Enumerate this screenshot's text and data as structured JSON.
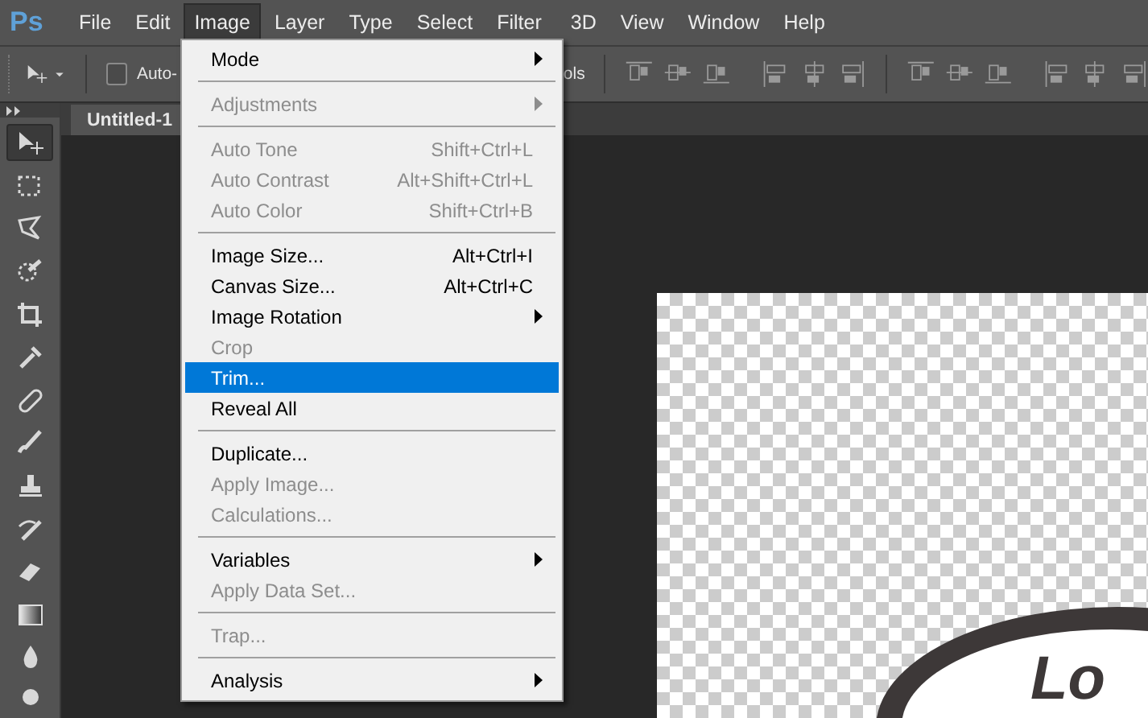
{
  "menubar": {
    "logo": "Ps",
    "items": [
      {
        "label": "File",
        "selected": false
      },
      {
        "label": "Edit",
        "selected": false
      },
      {
        "label": "Image",
        "selected": true
      },
      {
        "label": "Layer",
        "selected": false
      },
      {
        "label": "Type",
        "selected": false
      },
      {
        "label": "Select",
        "selected": false
      },
      {
        "label": "Filter",
        "selected": false
      },
      {
        "label": "3D",
        "selected": false
      },
      {
        "label": "View",
        "selected": false
      },
      {
        "label": "Window",
        "selected": false
      },
      {
        "label": "Help",
        "selected": false
      }
    ]
  },
  "options_bar": {
    "auto_select": {
      "label": "Auto-",
      "checked": false
    },
    "transform_label": "ols"
  },
  "document_tab": {
    "title": "Untitled-1"
  },
  "tools": [
    {
      "kind": "move",
      "selected": true
    },
    {
      "kind": "marquee",
      "selected": false
    },
    {
      "kind": "lasso",
      "selected": false
    },
    {
      "kind": "quick-select",
      "selected": false
    },
    {
      "kind": "crop",
      "selected": false
    },
    {
      "kind": "eyedropper",
      "selected": false
    },
    {
      "kind": "healing",
      "selected": false
    },
    {
      "kind": "brush",
      "selected": false
    },
    {
      "kind": "stamp",
      "selected": false
    },
    {
      "kind": "history-brush",
      "selected": false
    },
    {
      "kind": "eraser",
      "selected": false
    },
    {
      "kind": "gradient",
      "selected": false
    },
    {
      "kind": "blur",
      "selected": false
    },
    {
      "kind": "dodge",
      "selected": false
    }
  ],
  "image_menu": [
    {
      "kind": "item",
      "label": "Mode",
      "disabled": false,
      "submenu": true,
      "selected": false
    },
    {
      "kind": "separator"
    },
    {
      "kind": "item",
      "label": "Adjustments",
      "disabled": true,
      "submenu": true,
      "selected": false
    },
    {
      "kind": "separator"
    },
    {
      "kind": "item",
      "label": "Auto Tone",
      "shortcut": "Shift+Ctrl+L",
      "disabled": true,
      "submenu": false,
      "selected": false
    },
    {
      "kind": "item",
      "label": "Auto Contrast",
      "shortcut": "Alt+Shift+Ctrl+L",
      "disabled": true,
      "submenu": false,
      "selected": false
    },
    {
      "kind": "item",
      "label": "Auto Color",
      "shortcut": "Shift+Ctrl+B",
      "disabled": true,
      "submenu": false,
      "selected": false
    },
    {
      "kind": "separator"
    },
    {
      "kind": "item",
      "label": "Image Size...",
      "shortcut": "Alt+Ctrl+I",
      "disabled": false,
      "submenu": false,
      "selected": false
    },
    {
      "kind": "item",
      "label": "Canvas Size...",
      "shortcut": "Alt+Ctrl+C",
      "disabled": false,
      "submenu": false,
      "selected": false
    },
    {
      "kind": "item",
      "label": "Image Rotation",
      "disabled": false,
      "submenu": true,
      "selected": false
    },
    {
      "kind": "item",
      "label": "Crop",
      "disabled": true,
      "submenu": false,
      "selected": false
    },
    {
      "kind": "item",
      "label": "Trim...",
      "disabled": false,
      "submenu": false,
      "selected": true
    },
    {
      "kind": "item",
      "label": "Reveal All",
      "disabled": false,
      "submenu": false,
      "selected": false
    },
    {
      "kind": "separator"
    },
    {
      "kind": "item",
      "label": "Duplicate...",
      "disabled": false,
      "submenu": false,
      "selected": false
    },
    {
      "kind": "item",
      "label": "Apply Image...",
      "disabled": true,
      "submenu": false,
      "selected": false
    },
    {
      "kind": "item",
      "label": "Calculations...",
      "disabled": true,
      "submenu": false,
      "selected": false
    },
    {
      "kind": "separator"
    },
    {
      "kind": "item",
      "label": "Variables",
      "disabled": false,
      "submenu": true,
      "selected": false
    },
    {
      "kind": "item",
      "label": "Apply Data Set...",
      "disabled": true,
      "submenu": false,
      "selected": false
    },
    {
      "kind": "separator"
    },
    {
      "kind": "item",
      "label": "Trap...",
      "disabled": true,
      "submenu": false,
      "selected": false
    },
    {
      "kind": "separator"
    },
    {
      "kind": "item",
      "label": "Analysis",
      "disabled": false,
      "submenu": true,
      "selected": false
    }
  ],
  "canvas": {
    "logo_text": "Lo"
  }
}
